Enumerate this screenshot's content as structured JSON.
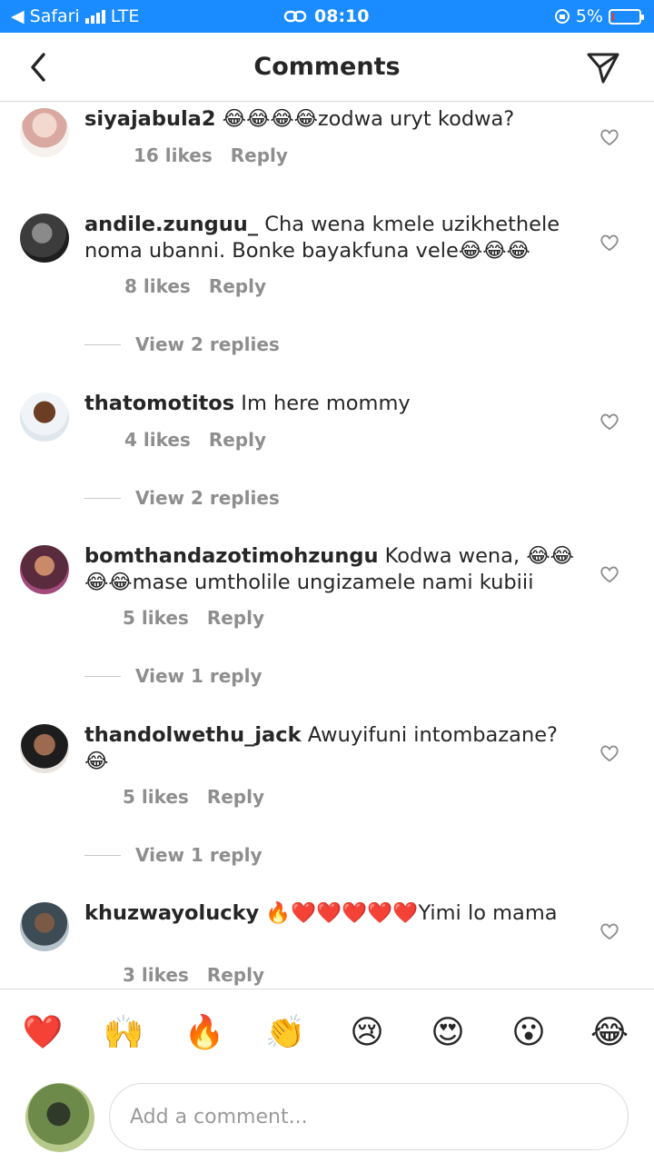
{
  "status_bar": {
    "back_app": "◀ Safari",
    "carrier": "LTE",
    "time": "08:10",
    "battery": "5%",
    "battery_level": 0.05
  },
  "header": {
    "title": "Comments"
  },
  "comments": [
    {
      "username": "siyajabula2",
      "text": " 😂😂😂😂zodwa uryt kodwa?",
      "likes": "16 likes",
      "reply": "Reply",
      "view_replies": ""
    },
    {
      "username": "andile.zunguu_",
      "text": " Cha wena kmele uzikhethele noma ubanni. Bonke bayakfuna vele😂😂😂",
      "likes": "8 likes",
      "reply": "Reply",
      "view_replies": "View 2 replies"
    },
    {
      "username": "thatomotitos",
      "text": " Im here mommy",
      "likes": "4 likes",
      "reply": "Reply",
      "view_replies": "View 2 replies"
    },
    {
      "username": "bomthandazotimohzungu",
      "text": " Kodwa wena, 😂😂😂😂mase umtholile ungizamele nami kubiii",
      "likes": "5 likes",
      "reply": "Reply",
      "view_replies": "View 1 reply"
    },
    {
      "username": "thandolwethu_jack",
      "text": " Awuyifuni intombazane? 😂",
      "likes": "5 likes",
      "reply": "Reply",
      "view_replies": "View 1 reply"
    },
    {
      "username": "khuzwayolucky",
      "text": " 🔥❤️❤️❤️❤️❤️Yimi lo mama",
      "likes": "3 likes",
      "reply": "Reply",
      "view_replies": ""
    }
  ],
  "emoji_bar": [
    "❤️",
    "🙌",
    "🔥",
    "👏",
    "😢",
    "😍",
    "😮",
    "😂"
  ],
  "composer": {
    "placeholder": "Add a comment..."
  },
  "colors": {
    "status_bar": "#1a8cff",
    "text": "#262626",
    "secondary": "#8e8e8e",
    "divider": "#dbdbdb"
  }
}
